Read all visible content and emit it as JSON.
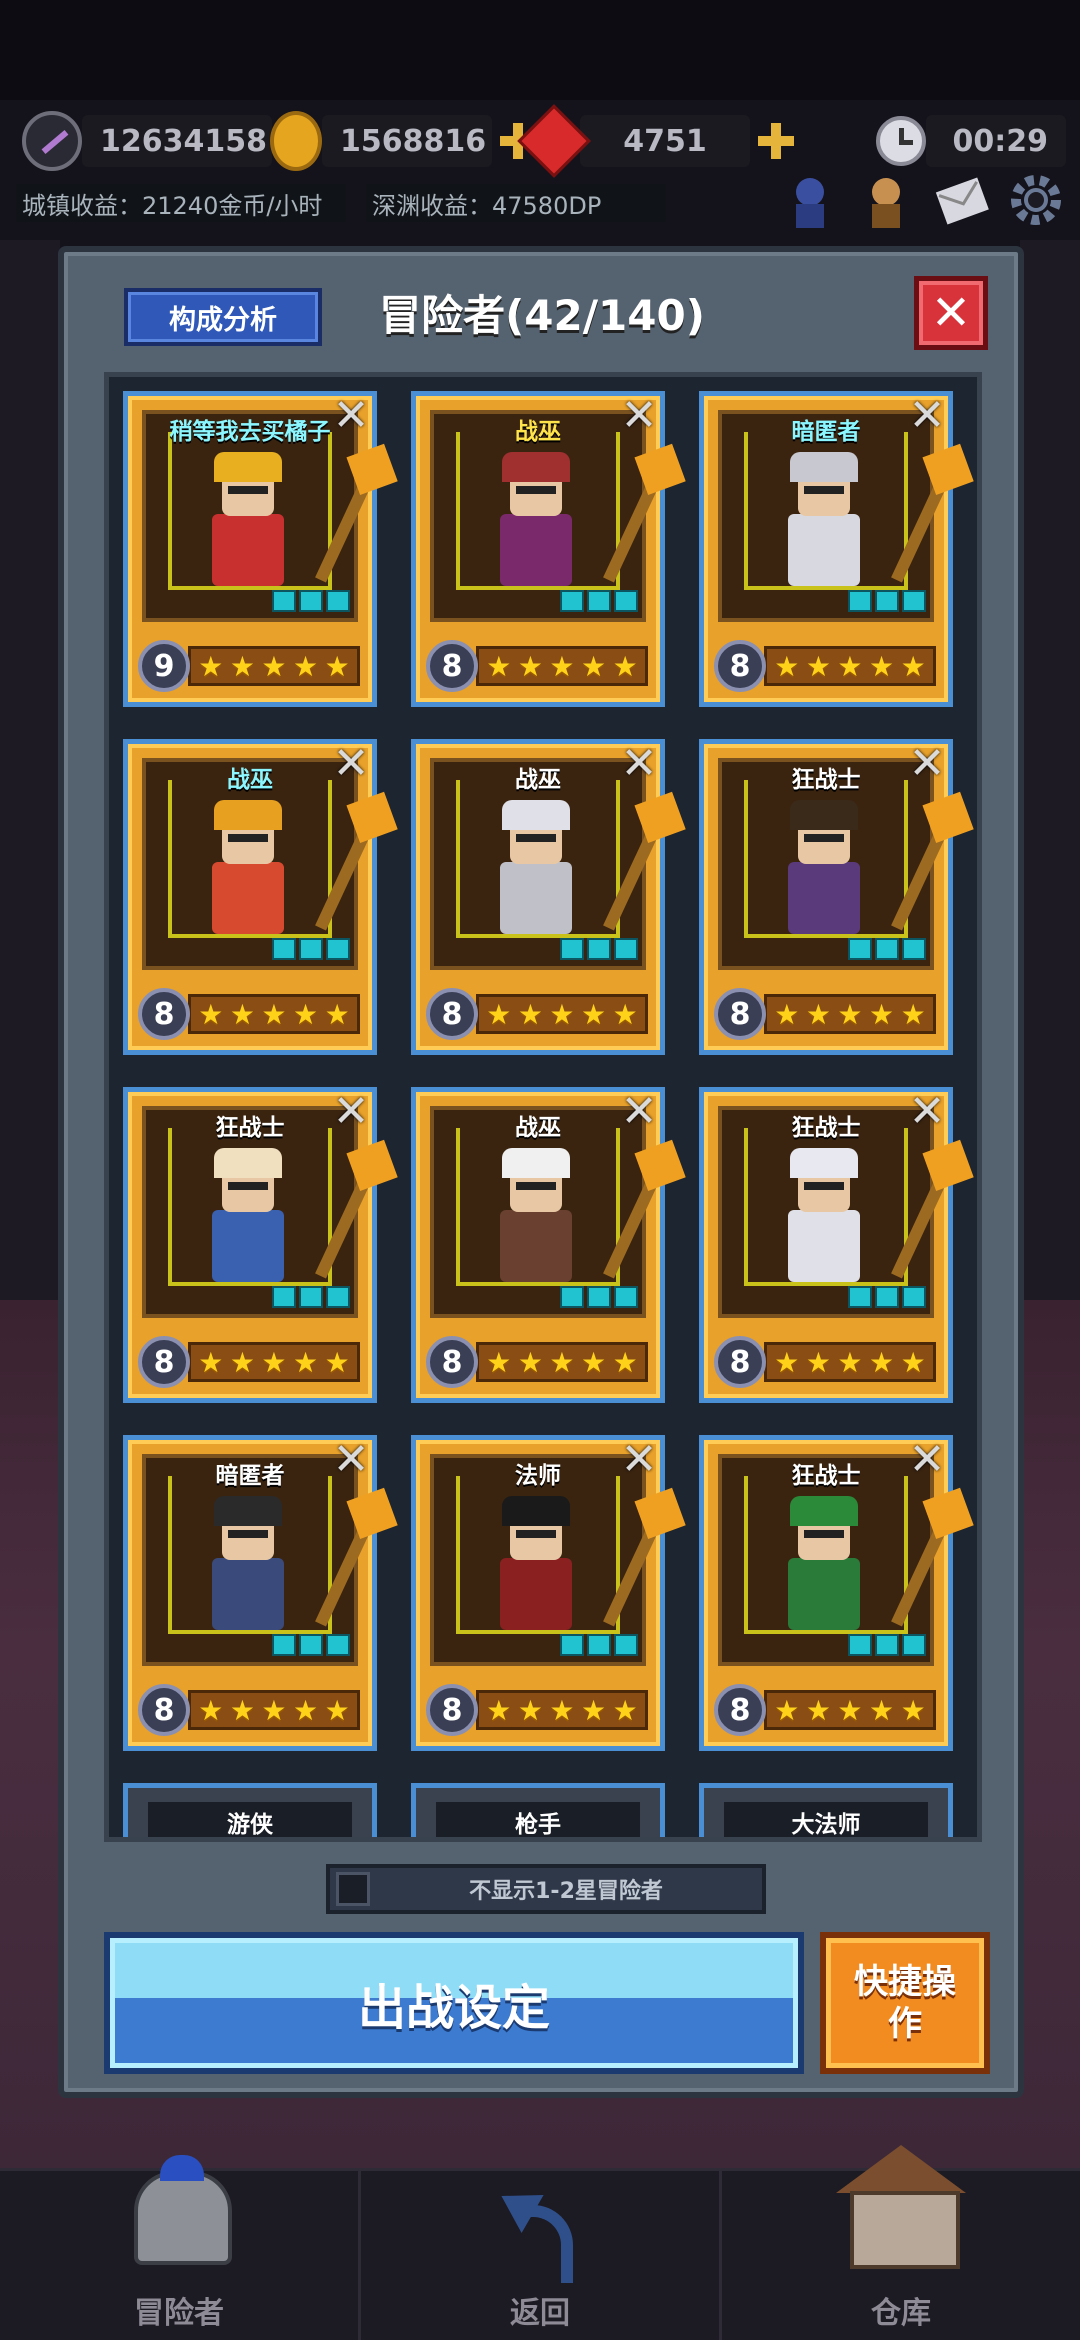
{
  "resources": {
    "feather": "12634158",
    "gold": "1568816",
    "gems": "4751",
    "timer": "00:29"
  },
  "income": {
    "town": "城镇收益：21240金币/小时",
    "abyss": "深渊收益：47580DP"
  },
  "panel": {
    "analysis_label": "构成分析",
    "title": "冒险者(42/140)",
    "close_symbol": "✕",
    "filter_label": "不显示1-2星冒险者",
    "deploy_label": "出战设定",
    "quick_label": "快捷操作"
  },
  "cards": [
    {
      "name": "稍等我去买橘子",
      "level": "9",
      "stars": 5,
      "name_color": "cyan"
    },
    {
      "name": "战巫",
      "level": "8",
      "stars": 5,
      "name_color": "gold"
    },
    {
      "name": "暗匿者",
      "level": "8",
      "stars": 5,
      "name_color": "cyan"
    },
    {
      "name": "战巫",
      "level": "8",
      "stars": 5,
      "name_color": "cyan"
    },
    {
      "name": "战巫",
      "level": "8",
      "stars": 5,
      "name_color": "white"
    },
    {
      "name": "狂战士",
      "level": "8",
      "stars": 5,
      "name_color": "white"
    },
    {
      "name": "狂战士",
      "level": "8",
      "stars": 5,
      "name_color": "white"
    },
    {
      "name": "战巫",
      "level": "8",
      "stars": 5,
      "name_color": "white"
    },
    {
      "name": "狂战士",
      "level": "8",
      "stars": 5,
      "name_color": "white"
    },
    {
      "name": "暗匿者",
      "level": "8",
      "stars": 5,
      "name_color": "white"
    },
    {
      "name": "法师",
      "level": "8",
      "stars": 5,
      "name_color": "white"
    },
    {
      "name": "狂战士",
      "level": "8",
      "stars": 5,
      "name_color": "white"
    }
  ],
  "partial_cards": [
    "游侠",
    "枪手",
    "大法师"
  ],
  "bottom_nav": [
    {
      "label": "冒险者",
      "icon": "helmet-icon"
    },
    {
      "label": "返回",
      "icon": "return-arrow-icon"
    },
    {
      "label": "仓库",
      "icon": "warehouse-icon"
    }
  ],
  "colors": {
    "card_gold": "#e8a12a",
    "card_border": "#4a8fd4",
    "deploy_blue": "#3c7bd0",
    "quick_orange": "#f28c20",
    "close_red": "#d8323a"
  }
}
